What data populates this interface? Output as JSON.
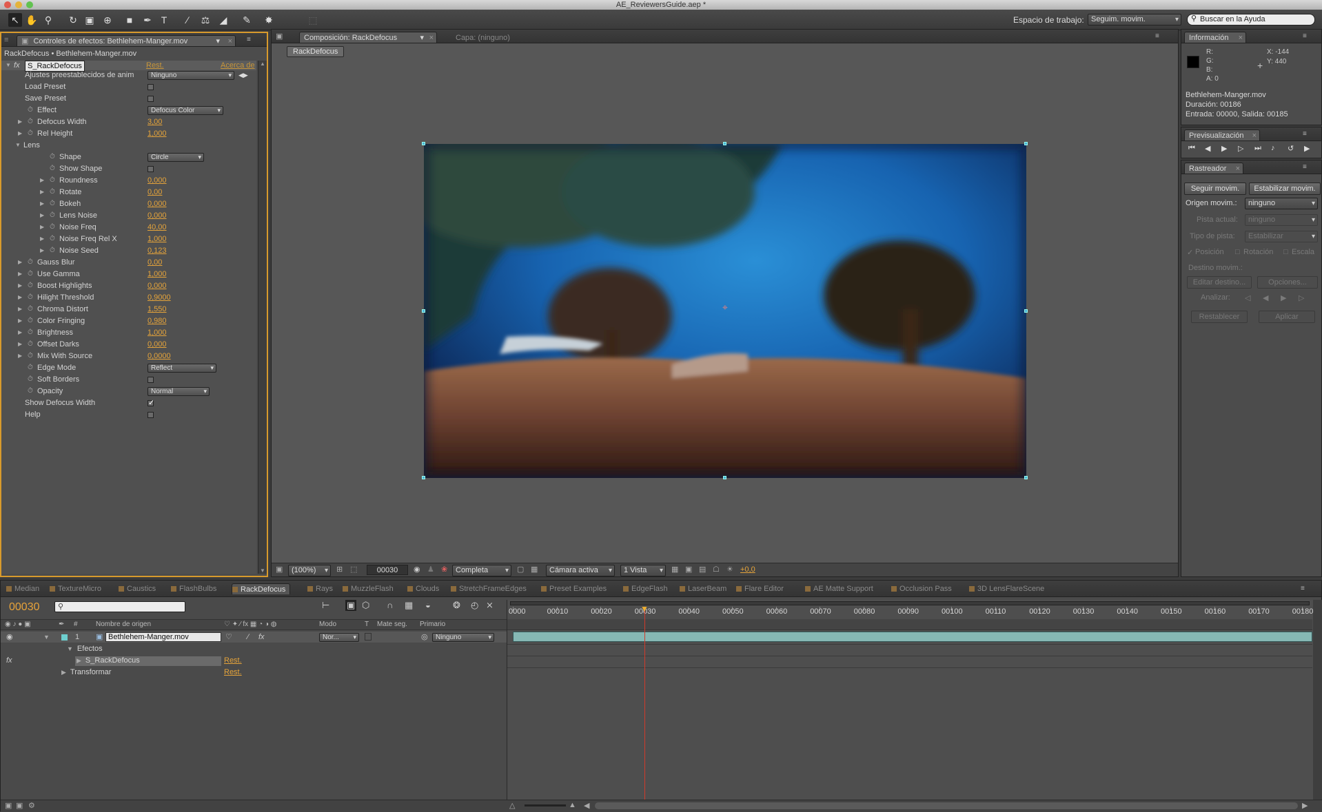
{
  "app": {
    "window_title": "AE_ReviewersGuide.aep *"
  },
  "toolbar": {
    "workspace_label": "Espacio de trabajo:",
    "workspace_value": "Seguim. movim.",
    "help_search_placeholder": "Buscar en la Ayuda",
    "tools": [
      "selection-tool-icon",
      "hand-tool-icon",
      "zoom-tool-icon",
      "rotate-tool-icon",
      "camera-orbit-icon",
      "pan-behind-icon",
      "rectangle-tool-icon",
      "pen-tool-icon",
      "type-tool-icon",
      "brush-tool-icon",
      "clone-stamp-icon",
      "eraser-tool-icon",
      "roto-brush-icon",
      "puppet-pin-icon"
    ]
  },
  "effects_panel": {
    "tab_label": "Controles de efectos: Bethlehem-Manger.mov",
    "breadcrumb": "RackDefocus • Bethlehem-Manger.mov",
    "effect_name": "S_RackDefocus",
    "reset_label": "Rest.",
    "about_label": "Acerca de",
    "rows": [
      {
        "label": "Ajustes preestablecidos de anim",
        "kind": "preset",
        "value": "Ninguno"
      },
      {
        "label": "Load Preset",
        "kind": "checkbox",
        "checked": false
      },
      {
        "label": "Save Preset",
        "kind": "checkbox",
        "checked": false
      },
      {
        "label": "Effect",
        "kind": "dropdown",
        "value": "Defocus Color"
      },
      {
        "label": "Defocus Width",
        "kind": "number",
        "value": "3,00"
      },
      {
        "label": "Rel Height",
        "kind": "number",
        "value": "1,000"
      },
      {
        "label": "Lens",
        "kind": "group"
      },
      {
        "label": "Shape",
        "kind": "dropdown",
        "value": "Circle",
        "indent": 2
      },
      {
        "label": "Show Shape",
        "kind": "checkbox",
        "checked": false,
        "indent": 2
      },
      {
        "label": "Roundness",
        "kind": "number",
        "value": "0,000",
        "indent": 2
      },
      {
        "label": "Rotate",
        "kind": "number",
        "value": "0,00",
        "indent": 2
      },
      {
        "label": "Bokeh",
        "kind": "number",
        "value": "0,000",
        "indent": 2
      },
      {
        "label": "Lens Noise",
        "kind": "number",
        "value": "0,000",
        "indent": 2
      },
      {
        "label": "Noise Freq",
        "kind": "number",
        "value": "40,00",
        "indent": 2
      },
      {
        "label": "Noise Freq Rel X",
        "kind": "number",
        "value": "1,000",
        "indent": 2
      },
      {
        "label": "Noise Seed",
        "kind": "number",
        "value": "0,123",
        "indent": 2
      },
      {
        "label": "Gauss Blur",
        "kind": "number",
        "value": "0,00"
      },
      {
        "label": "Use Gamma",
        "kind": "number",
        "value": "1,000"
      },
      {
        "label": "Boost Highlights",
        "kind": "number",
        "value": "0,000"
      },
      {
        "label": "Hilight Threshold",
        "kind": "number",
        "value": "0,9000"
      },
      {
        "label": "Chroma Distort",
        "kind": "number",
        "value": "1,550"
      },
      {
        "label": "Color Fringing",
        "kind": "number",
        "value": "0,980"
      },
      {
        "label": "Brightness",
        "kind": "number",
        "value": "1,000"
      },
      {
        "label": "Offset Darks",
        "kind": "number",
        "value": "0,000"
      },
      {
        "label": "Mix With Source",
        "kind": "number",
        "value": "0,0000"
      },
      {
        "label": "Edge Mode",
        "kind": "dropdown",
        "value": "Reflect"
      },
      {
        "label": "Soft Borders",
        "kind": "checkbox",
        "checked": false
      },
      {
        "label": "Opacity",
        "kind": "dropdown",
        "value": "Normal"
      },
      {
        "label": "Show Defocus Width",
        "kind": "checkbox",
        "checked": true,
        "plain": true
      },
      {
        "label": "Help",
        "kind": "checkbox",
        "checked": false,
        "plain": true
      }
    ]
  },
  "comp_panel": {
    "tab_label": "Composición: RackDefocus",
    "layer_tab_label": "Capa: (ninguno)",
    "comp_name_chip": "RackDefocus",
    "footer": {
      "zoom": "(100%)",
      "timecode": "00030",
      "resolution": "Completa",
      "camera": "Cámara activa",
      "views": "1 Vista",
      "exposure": "+0,0"
    }
  },
  "info_panel": {
    "tab_label": "Información",
    "r": "R:",
    "g": "G:",
    "b": "B:",
    "a": "A:  0",
    "x": "X:  -144",
    "y": "Y:  440",
    "file": "Bethlehem-Manger.mov",
    "duration": "Duración: 00186",
    "inout": "Entrada: 00000, Salida: 00185"
  },
  "preview_panel": {
    "tab_label": "Previsualización"
  },
  "tracker_panel": {
    "tab_label": "Rastreador",
    "track_button": "Seguir movim.",
    "stabilize_button": "Estabilizar movim.",
    "source_label": "Origen movim.:",
    "source_value": "ninguno",
    "current_track_label": "Pista actual:",
    "current_track_value": "ninguno",
    "track_type_label": "Tipo de pista:",
    "track_type_value": "Estabilizar",
    "position_label": "Posición",
    "rotation_label": "Rotación",
    "scale_label": "Escala",
    "target_label": "Destino movim.:",
    "edit_target_button": "Editar destino...",
    "options_button": "Opciones...",
    "analyze_label": "Analizar:",
    "reset_button": "Restablecer",
    "apply_button": "Aplicar"
  },
  "timeline": {
    "tabs": [
      "Median",
      "TextureMicro",
      "Caustics",
      "FlashBulbs",
      "RackDefocus",
      "Rays",
      "MuzzleFlash",
      "Clouds",
      "StretchFrameEdges",
      "Preset Examples",
      "EdgeFlash",
      "LaserBeam",
      "Flare Editor",
      "AE Matte Support",
      "Occlusion Pass",
      "3D LensFlareScene"
    ],
    "active_tab": "RackDefocus",
    "current_time": "00030",
    "columns": {
      "source_name": "Nombre de origen",
      "mode": "Modo",
      "t": "T",
      "track_matte": "Mate seg.",
      "parent": "Primario",
      "number": "#"
    },
    "layer": {
      "number": "1",
      "name": "Bethlehem-Manger.mov",
      "mode": "Nor...",
      "parent": "Ninguno"
    },
    "effects_label": "Efectos",
    "effect_item": "S_RackDefocus",
    "transform_label": "Transformar",
    "reset_label": "Rest.",
    "ruler": [
      "0000",
      "00010",
      "00020",
      "00030",
      "00040",
      "00050",
      "00060",
      "00070",
      "00080",
      "00090",
      "00100",
      "00110",
      "00120",
      "00130",
      "00140",
      "00150",
      "00160",
      "00170",
      "00180"
    ]
  }
}
